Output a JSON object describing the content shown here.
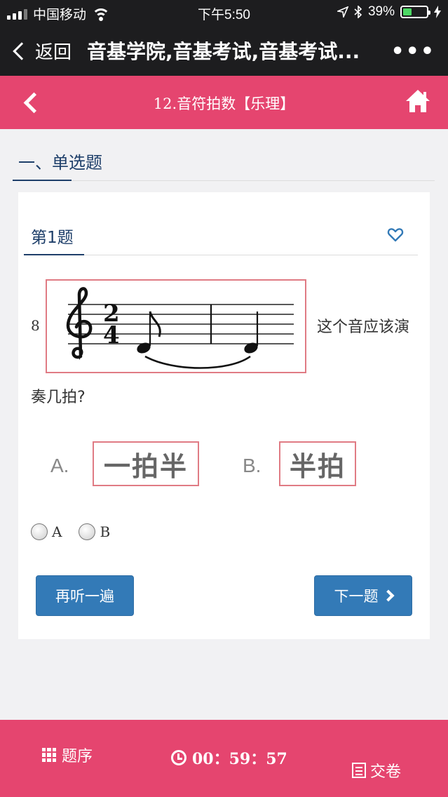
{
  "status_bar": {
    "carrier": "中国移动",
    "time": "下午5:50",
    "battery": "39%",
    "battery_level": 0.39
  },
  "wechat_bar": {
    "back_label": "返回",
    "title": "音基学院,音基考试,音基考试...",
    "more_label": "•••"
  },
  "header": {
    "title": "12.音符拍数【乐理】"
  },
  "section": {
    "title": "一、单选题"
  },
  "question": {
    "title": "第1题",
    "number": "8",
    "text_part1": "这个音应该演",
    "text_part2": "奏几拍?",
    "staff_time_signature": {
      "top": "2",
      "bottom": "4"
    },
    "options": [
      {
        "letter": "A.",
        "text": "一拍半"
      },
      {
        "letter": "B.",
        "text": "半拍"
      }
    ],
    "radio_labels": [
      "A",
      "B"
    ],
    "replay_button": "再听一遍",
    "next_button": "下一题"
  },
  "footer": {
    "order_label": "题序",
    "timer": "00：59：57",
    "submit_label": "交卷"
  },
  "colors": {
    "primary_pink": "#e5456f",
    "button_blue": "#337ab7",
    "title_navy": "#1e3f6a",
    "option_border": "#e07b84"
  },
  "icons": [
    "chevron-left-icon",
    "home-icon",
    "heart-outline-icon",
    "grid-icon",
    "clock-icon",
    "document-icon",
    "chevron-right-icon"
  ]
}
